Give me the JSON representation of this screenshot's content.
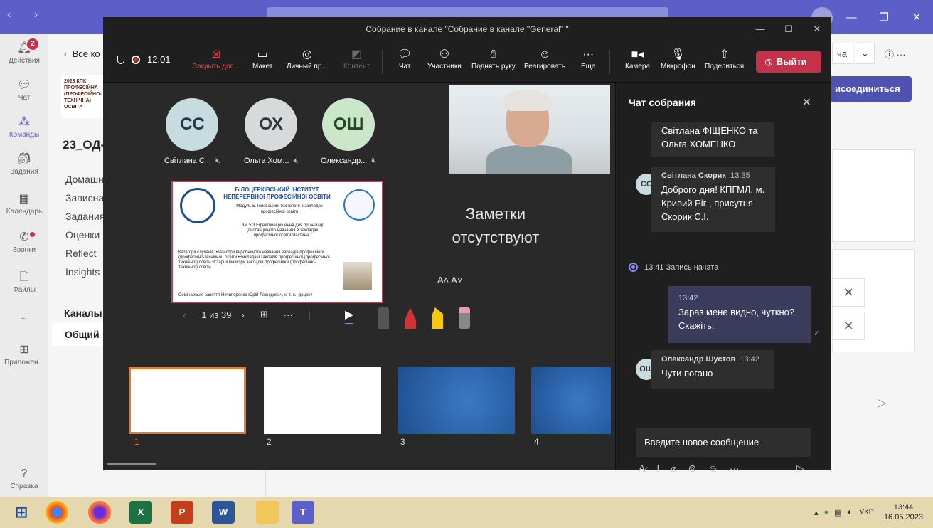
{
  "teams": {
    "rail": [
      {
        "label": "Действия",
        "badge": "2"
      },
      {
        "label": "Чат"
      },
      {
        "label": "Команды"
      },
      {
        "label": "Задания"
      },
      {
        "label": "Календарь"
      },
      {
        "label": "Звонки"
      },
      {
        "label": "Файлы"
      },
      {
        "label": "..."
      },
      {
        "label": "Приложен..."
      },
      {
        "label": "Справка"
      }
    ],
    "back_label": "Все ко",
    "logo_text": "2023 КПК ПРОФЕСІЙНА (ПРОФЕСІЙНО-ТЕХНІЧНА) ОСВІТА",
    "team_name": "23_ОД-",
    "nav": [
      "Домашн",
      "Записная",
      "Задания",
      "Оценки",
      "Reflect",
      "Insights"
    ],
    "channels_label": "Каналы",
    "channel_general": "Общий",
    "join_label": "исоединиться",
    "top_right_label": "ча"
  },
  "meeting": {
    "window_title": "Собрание в канале \"Собрание в канале \"General\" \"",
    "timer": "12:01",
    "toolbar": {
      "stop_share": "Закрыть дос...",
      "layout": "Макет",
      "personal": "Личный пр...",
      "content": "Контент",
      "chat": "Чат",
      "participants": "Участники",
      "raise_hand": "Поднять руку",
      "react": "Реагировать",
      "more": "Еще",
      "camera": "Камера",
      "mic": "Микрофон",
      "share": "Поделиться",
      "leave": "Выйти"
    },
    "participants": [
      {
        "initials": "СС",
        "name": "Світлана С...",
        "bg": "#c7dbe0",
        "fg": "#1d3f4b"
      },
      {
        "initials": "ОХ",
        "name": "Ольга Хом...",
        "bg": "#d7dadb",
        "fg": "#2b3437"
      },
      {
        "initials": "ОШ",
        "name": "Олександр...",
        "bg": "#cbe6c8",
        "fg": "#1f4a22"
      }
    ],
    "slide": {
      "title": "БІЛОЦЕРКІВСЬКИЙ ІНСТИТУТ НЕПЕРЕРВНОЇ ПРОФЕСІЙНОЇ ОСВІТИ",
      "module": "Модуль 5. Інноваційні технології в закладах професійної освіти",
      "topic": "ЗМ 5.3 Ефективні рішення для організації дистанційного навчання в закладах професійної освіти Частина 1",
      "categories": "Категорії слухачів: •Майстри виробничого навчання закладів професійної (професійно-технічної) освіти •Викладачі закладів професійної (професійно-технічної) освіти •Старші майстри закладів професійної (професійно-технічної) освіти",
      "footer": "Семінарське заняття     Нечипоренко Юрій Леонідович, к. т. н., доцент"
    },
    "notes": "Заметки отсутствуют",
    "font_controls": "A˄  A˅",
    "page_counter": "1 из 39",
    "thumb_numbers": [
      "1",
      "2",
      "3",
      "4"
    ],
    "chat": {
      "title": "Чат собрания",
      "messages": [
        {
          "text": "Світлана ФІЩЕНКО та Ольга ХОМЕНКО"
        },
        {
          "initials": "СС",
          "author": "Світлана Скорик",
          "time": "13:35",
          "text": "Доброго дня! КПГМЛ, м. Кривий Ріг , присутня Скорик С.І."
        },
        {
          "system": "13:41  Запись начата"
        },
        {
          "time": "13:42",
          "text": "Зараз мене видно, чуткно? Скажіть."
        },
        {
          "initials": "ОШ",
          "author": "Олександр Шустов",
          "time": "13:42",
          "text": "Чути погано"
        }
      ],
      "compose_placeholder": "Введите новое сообщение"
    }
  },
  "taskbar": {
    "lang": "УКР",
    "time": "13:44",
    "date": "16.05.2023"
  }
}
